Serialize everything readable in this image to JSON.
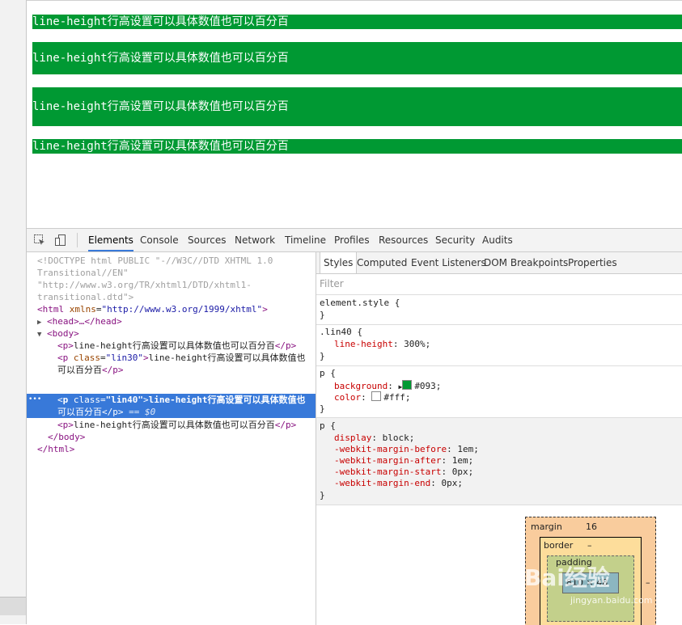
{
  "page": {
    "paragraphs": [
      "line-height行高设置可以具体数值也可以百分百",
      "line-height行高设置可以具体数值也可以百分百",
      "line-height行高设置可以具体数值也可以百分百",
      "line-height行高设置可以具体数值也可以百分百"
    ],
    "background_color": "#009933",
    "text_color": "#ffffff"
  },
  "devtools": {
    "tabs": [
      "Elements",
      "Console",
      "Sources",
      "Network",
      "Timeline",
      "Profiles",
      "Resources",
      "Security",
      "Audits"
    ],
    "active_tab": "Elements",
    "toolbar_icons": [
      "inspect-element-icon",
      "device-mode-icon"
    ],
    "dom": {
      "doctype_lines": [
        "<!DOCTYPE html PUBLIC \"-//W3C//DTD XHTML 1.0",
        "Transitional//EN\"",
        "\"http://www.w3.org/TR/xhtml1/DTD/xhtml1-",
        "transitional.dtd\">"
      ],
      "html_open_tag": "html",
      "html_attr": "xmlns",
      "html_attr_value": "\"http://www.w3.org/1999/xhtml\"",
      "head_collapsed": "<head>…</head>",
      "body_open": "<body>",
      "p1_open": "<p>",
      "p1_text": "line-height行高设置可以具体数值也可以百分百",
      "p1_close": "</p>",
      "p2_tag": "p",
      "p2_attr": "class",
      "p2_attr_value": "\"lin30\"",
      "p2_text_line1": "line-height行高设置可以具体数值也",
      "p2_text_line2": "可以百分百",
      "p2_close": "</p>",
      "ellipsis": "•••",
      "p3_tag": "p",
      "p3_attr": "class",
      "p3_attr_value": "\"lin40\"",
      "p3_text_line1": "line-height行高设置可以具体数值也",
      "p3_text_line2": "可以百分百",
      "p3_close": "</p>",
      "p3_marker": "== $0",
      "p4_open": "<p>",
      "p4_text": "line-height行高设置可以具体数值也可以百分百",
      "p4_close": "</p>",
      "body_close": "</body>",
      "html_close": "</html>"
    },
    "styles": {
      "subtabs": [
        "Styles",
        "Computed",
        "Event Listeners",
        "DOM Breakpoints",
        "Properties"
      ],
      "active_subtab": "Styles",
      "filter_placeholder": "Filter",
      "element_style_selector": "element.style {",
      "rule_close": "}",
      "lin40_selector": ".lin40 {",
      "lin40_prop": "line-height",
      "lin40_value": "300%;",
      "p_selector": "p {",
      "bg_prop": "background",
      "bg_value": "#093;",
      "bg_swatch_color": "#009933",
      "color_prop": "color",
      "color_value": "#fff;",
      "color_swatch_color": "#ffffff",
      "ua_selector": "p {",
      "ua_props": [
        {
          "name": "display",
          "value": "block;"
        },
        {
          "name": "-webkit-margin-before",
          "value": "1em;"
        },
        {
          "name": "-webkit-margin-after",
          "value": "1em;"
        },
        {
          "name": "-webkit-margin-start",
          "value": "0px;"
        },
        {
          "name": "-webkit-margin-end",
          "value": "0px;"
        }
      ]
    },
    "box_model": {
      "margin_label": "margin",
      "margin_value": "16",
      "border_label": "border",
      "border_value": "–",
      "padding_label": "padding",
      "content_value": "810 × 48",
      "bottom_dash": "–",
      "side_dash": "–"
    }
  },
  "watermark": {
    "text": "Bai经验",
    "sub": "jingyan.baidu.com"
  }
}
